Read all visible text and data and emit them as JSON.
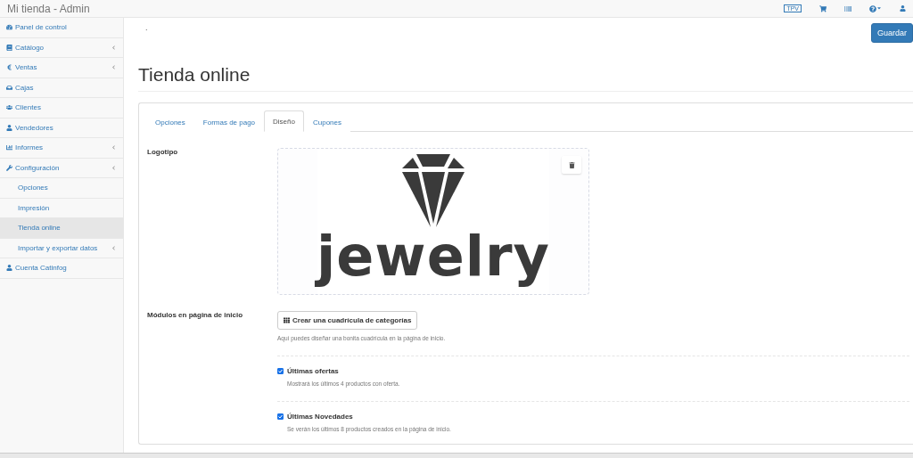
{
  "navbar": {
    "brand": "Mi tienda - Admin",
    "tpv": "TPV"
  },
  "sidebar": {
    "items": [
      {
        "label": "Panel de control",
        "has_caret": false,
        "selected": false
      },
      {
        "label": "Catálogo",
        "has_caret": true,
        "selected": false
      },
      {
        "label": "Ventas",
        "has_caret": true,
        "selected": false
      },
      {
        "label": "Cajas",
        "has_caret": false,
        "selected": false
      },
      {
        "label": "Clientes",
        "has_caret": false,
        "selected": false
      },
      {
        "label": "Vendedores",
        "has_caret": false,
        "selected": false
      },
      {
        "label": "Informes",
        "has_caret": true,
        "selected": false
      },
      {
        "label": "Configuración",
        "has_caret": true,
        "selected": false,
        "children": [
          {
            "label": "Opciones",
            "has_caret": false,
            "selected": false
          },
          {
            "label": "Impresión",
            "has_caret": false,
            "selected": false
          },
          {
            "label": "Tienda online",
            "has_caret": false,
            "selected": true
          },
          {
            "label": "Importar y exportar datos",
            "has_caret": true,
            "selected": false
          }
        ]
      },
      {
        "label": "Cuenta Catinfog",
        "has_caret": false,
        "selected": false
      }
    ]
  },
  "breadcrumb": ".",
  "save_button": "Guardar",
  "page_title": "Tienda online",
  "tabs": [
    {
      "label": "Opciones",
      "selected": false
    },
    {
      "label": "Formas de pago",
      "selected": false
    },
    {
      "label": "Diseño",
      "selected": true
    },
    {
      "label": "Cupones",
      "selected": false
    }
  ],
  "logo_section": {
    "label": "Logotipo",
    "logo_text": "jewelry"
  },
  "modules_section": {
    "label": "Módulos en página de inicio",
    "grid_button": "Crear una cuadrícula de categorías",
    "grid_help": "Aquí puedes diseñar una bonita cuadrícula en la página de inicio.",
    "options": [
      {
        "label": "Últimas ofertas",
        "help": "Mostrará los últimos 4 productos con oferta.",
        "checked": true
      },
      {
        "label": "Últimas Novedades",
        "help": "Se verán los últimos 8 productos creados en la página de inicio.",
        "checked": true
      }
    ]
  }
}
